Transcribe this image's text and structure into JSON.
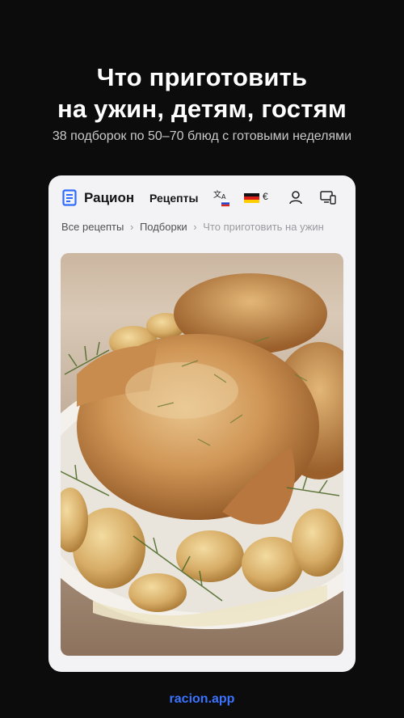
{
  "hero": {
    "title_line1": "Что приготовить",
    "title_line2": "на ужин, детям, гостям",
    "subtitle": "38 подборок по 50–70 блюд с готовыми неделями"
  },
  "navbar": {
    "brand": "Рацион",
    "recipes_link": "Рецепты",
    "currency": "€",
    "icons": [
      "document-icon",
      "translate-icon",
      "flag-ru-icon",
      "flag-de-icon",
      "user-icon",
      "device-icon"
    ]
  },
  "breadcrumb": {
    "items": [
      "Все рецепты",
      "Подборки",
      "Что приготовить на ужин"
    ],
    "separator": "›"
  },
  "hero_image": {
    "subject": "roast-chicken-with-potatoes"
  },
  "footer": {
    "link": "racion.app"
  },
  "colors": {
    "background": "#0c0c0c",
    "card": "#f3f3f6",
    "accent": "#3b73ff"
  }
}
